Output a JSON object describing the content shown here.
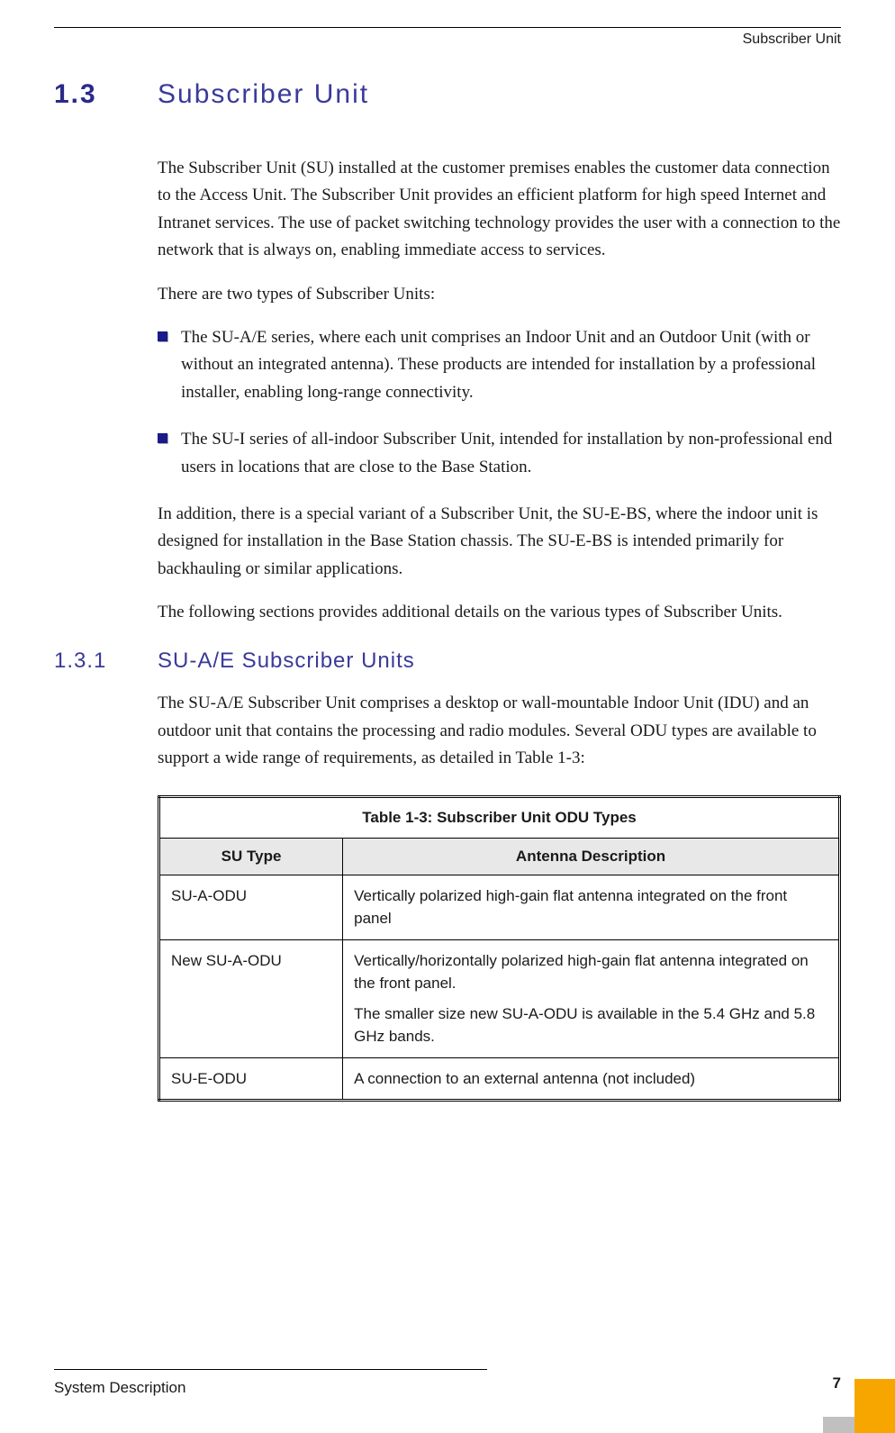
{
  "header": {
    "running_title": "Subscriber Unit"
  },
  "section": {
    "number": "1.3",
    "title": "Subscriber Unit",
    "para1": "The Subscriber Unit (SU) installed at the customer premises enables the customer data connection to the Access Unit. The Subscriber Unit provides an efficient platform for high speed Internet and Intranet services. The use of packet switching technology provides the user with a connection to the network that is always on, enabling immediate access to services.",
    "para2": "There are two types of Subscriber Units:",
    "bullets": [
      "The SU-A/E series, where each unit comprises an Indoor Unit and an Outdoor Unit (with or without an integrated antenna). These products are intended for installation by a professional installer, enabling long-range connectivity.",
      "The SU-I series of all-indoor Subscriber Unit, intended for installation by non-professional end users in locations that are close to the Base Station."
    ],
    "para3": "In addition, there is a special variant of a Subscriber Unit, the SU-E-BS, where the indoor unit is designed for installation in the Base Station chassis. The SU-E-BS is intended primarily for backhauling or similar applications.",
    "para4": "The following sections provides additional details on the various types of Subscriber Units."
  },
  "subsection": {
    "number": "1.3.1",
    "title": "SU-A/E Subscriber Units",
    "para1": "The SU-A/E Subscriber Unit comprises a desktop or wall-mountable Indoor Unit (IDU) and an outdoor unit that contains the processing and radio modules. Several ODU types are available to support a wide range of requirements, as detailed in Table 1-3:"
  },
  "chart_data": {
    "type": "table",
    "title": "Table 1-3: Subscriber Unit ODU Types",
    "columns": [
      "SU Type",
      "Antenna Description"
    ],
    "rows": [
      {
        "su_type": "SU-A-ODU",
        "description": [
          "Vertically polarized high-gain flat antenna integrated on the front panel"
        ]
      },
      {
        "su_type": "New SU-A-ODU",
        "description": [
          "Vertically/horizontally polarized high-gain flat antenna integrated on the front panel.",
          "The smaller size new SU-A-ODU is available in the 5.4 GHz and 5.8 GHz bands."
        ]
      },
      {
        "su_type": "SU-E-ODU",
        "description": [
          "A connection to an external antenna (not included)"
        ]
      }
    ]
  },
  "footer": {
    "left_text": "System Description",
    "page_number": "7"
  }
}
